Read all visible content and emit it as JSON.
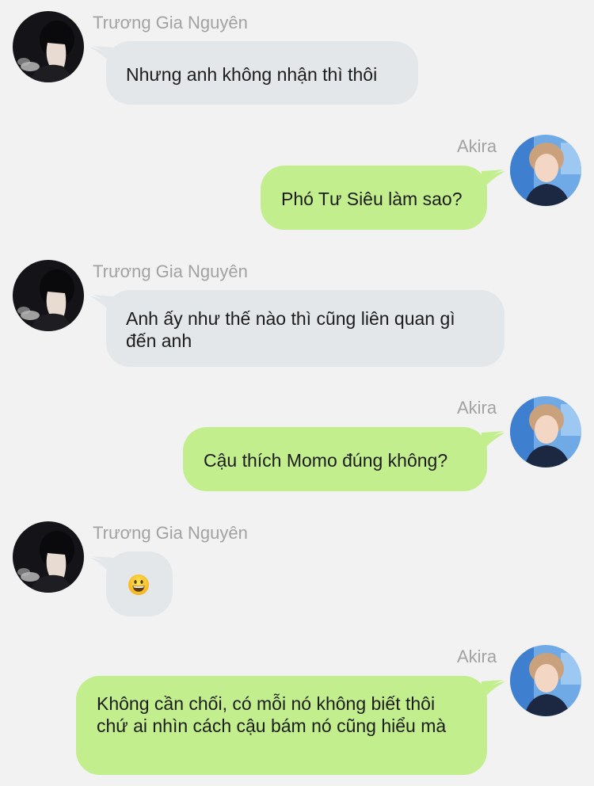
{
  "colors": {
    "background": "#f2f2f2",
    "incoming_bubble": "#e4e7ea",
    "outgoing_bubble": "#c2ee8d",
    "name_text": "#a2a2a2",
    "message_text": "#1c1c1c"
  },
  "contacts": {
    "incoming_name": "Trương Gia Nguyên",
    "outgoing_name": "Akira"
  },
  "messages": [
    {
      "sender": "Trương Gia Nguyên",
      "direction": "incoming",
      "text": "Nhưng anh không nhận thì thôi"
    },
    {
      "sender": "Akira",
      "direction": "outgoing",
      "text": "Phó Tư Siêu làm sao?"
    },
    {
      "sender": "Trương Gia Nguyên",
      "direction": "incoming",
      "text": "Anh ấy như thế nào thì cũng liên quan gì đến anh"
    },
    {
      "sender": "Akira",
      "direction": "outgoing",
      "text": "Cậu thích Momo đúng không?"
    },
    {
      "sender": "Trương Gia Nguyên",
      "direction": "incoming",
      "text": "",
      "emoji": "grinning-face-emoji"
    },
    {
      "sender": "Akira",
      "direction": "outgoing",
      "text": "Không cần chối, có mỗi nó không biết thôi chứ ai nhìn cách cậu bám nó cũng hiểu mà"
    }
  ]
}
